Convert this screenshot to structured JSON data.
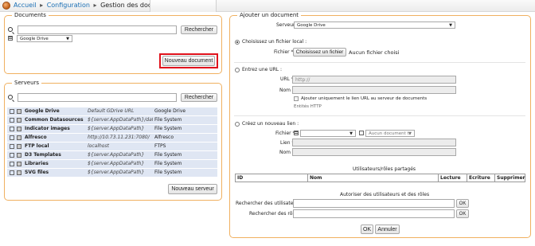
{
  "breadcrumb": {
    "home": "Accueil",
    "separator": "▸",
    "configuration": "Configuration",
    "current": "Gestion des documents"
  },
  "documents_panel": {
    "legend": "Documents",
    "search_value": "",
    "search_button": "Rechercher",
    "source_select": "Google Drive",
    "new_button": "Nouveau document"
  },
  "servers_panel": {
    "legend": "Serveurs",
    "search_value": "",
    "search_button": "Rechercher",
    "rows": [
      {
        "name": "Google Drive",
        "url": "Default GDrive URL",
        "type": "Google Drive"
      },
      {
        "name": "Common Datasources",
        "url": "${server.AppDataPath}/data...",
        "type": "File System"
      },
      {
        "name": "Indicator images",
        "url": "${server.AppDataPath}",
        "type": "File System"
      },
      {
        "name": "Alfresco",
        "url": "http://10.73.11.231:7080/",
        "type": "Alfresco"
      },
      {
        "name": "FTP local",
        "url": "localhost",
        "type": "FTPS"
      },
      {
        "name": "D3 Templates",
        "url": "${server.AppDataPath}",
        "type": "File System"
      },
      {
        "name": "Libraries",
        "url": "${server.AppDataPath}",
        "type": "File System"
      },
      {
        "name": "SVG files",
        "url": "${server.AppDataPath}",
        "type": "File System"
      }
    ],
    "new_button": "Nouveau serveur"
  },
  "add_panel": {
    "legend": "Ajouter un document",
    "server_label": "Serveur",
    "server_value": "Google Drive",
    "local_option": "Choisissez un fichier local :",
    "file_label": "Fichier",
    "required_mark": "*",
    "choose_button": "Choisissez un fichier",
    "no_file_text": "Aucun fichier choisi",
    "url_option": "Entrez une URL :",
    "url_label": "URL",
    "url_placeholder": "http://",
    "name_label": "Nom",
    "url_only_checkbox": "Ajouter uniquement le lien URL au serveur de documents",
    "http_entities": "Entités HTTP",
    "link_option": "Créez un nouveau lien :",
    "link_doc_select": "Aucun document tr",
    "link_label": "Lien",
    "link_name_label": "Nom",
    "shared_title": "Utilisateurs/rôles partagés",
    "table_headers": [
      "ID",
      "Nom",
      "Lecture",
      "Ecriture",
      "Supprimer"
    ],
    "authorize_title": "Autoriser des utilisateurs et des rôles",
    "search_users_label": "Rechercher des utilisateurs",
    "search_roles_label": "Rechercher des rôles",
    "ok_label": "OK",
    "submit_ok": "OK",
    "cancel_label": "Annuler"
  },
  "colors": {
    "panel_border": "#f0b060",
    "link": "#1a6fb5",
    "row_bg": "#dfe6f3",
    "highlight": "#e0121c"
  }
}
